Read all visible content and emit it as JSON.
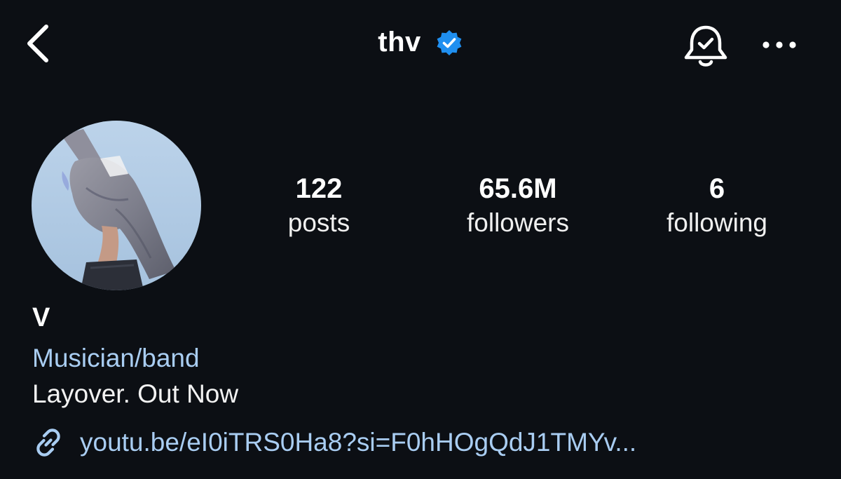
{
  "colors": {
    "background": "#0c0f14",
    "text": "#f5f5f5",
    "link": "#a9cdf2",
    "verified": "#1f8ff0"
  },
  "header": {
    "username": "thv",
    "back_icon": "chevron-left-icon",
    "verified_icon": "verified-badge-icon",
    "bell_icon": "notification-bell-icon",
    "more_icon": "more-horizontal-icon"
  },
  "profile": {
    "avatar_icon": "profile-photo",
    "stats": {
      "posts": {
        "count": "122",
        "label": "posts"
      },
      "followers": {
        "count": "65.6M",
        "label": "followers"
      },
      "following": {
        "count": "6",
        "label": "following"
      }
    },
    "display_name": "V",
    "category": "Musician/band",
    "bio": "Layover. Out Now",
    "link": {
      "icon": "link-icon",
      "text": "youtu.be/eI0iTRS0Ha8?si=F0hHOgQdJ1TMYv..."
    }
  }
}
